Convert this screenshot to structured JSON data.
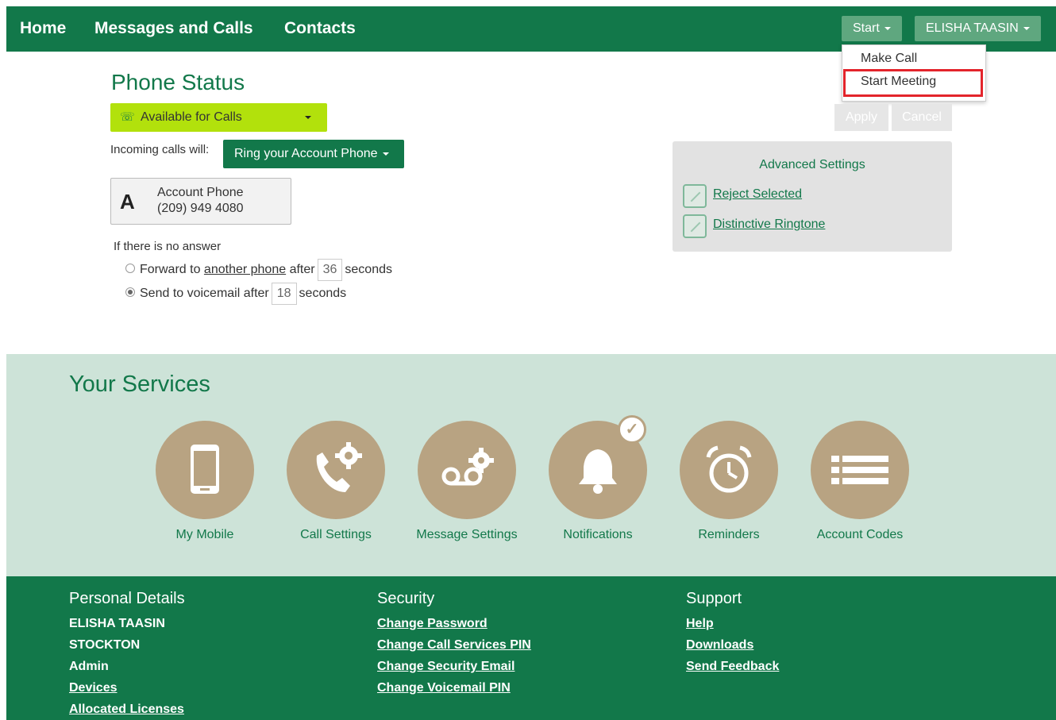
{
  "nav": {
    "home": "Home",
    "messages": "Messages and Calls",
    "contacts": "Contacts",
    "start": "Start",
    "user": "ELISHA TAASIN"
  },
  "start_menu": {
    "items": [
      "Make Call",
      "Start Meeting"
    ],
    "highlighted": "Start Meeting"
  },
  "phone_status": {
    "title": "Phone Status",
    "status": "Available for Calls",
    "incoming_label": "Incoming calls will:",
    "ring_option": "Ring your Account Phone",
    "account_letter": "A",
    "account_name": "Account Phone",
    "account_number": "(209) 949 4080",
    "no_answer": "If there is no answer",
    "forward_prefix": "Forward to",
    "forward_link": "another phone",
    "forward_after": "after",
    "forward_seconds": "36",
    "seconds_label": "seconds",
    "voicemail_prefix": "Send to voicemail after",
    "voicemail_seconds": "18",
    "selected_option": "voicemail"
  },
  "actions": {
    "apply": "Apply",
    "cancel": "Cancel"
  },
  "advanced": {
    "title": "Advanced Settings",
    "links": [
      "Reject Selected",
      "Distinctive Ringtone"
    ]
  },
  "services": {
    "title": "Your Services",
    "items": [
      {
        "label": "My Mobile",
        "icon": "mobile-phone-icon"
      },
      {
        "label": "Call Settings",
        "icon": "phone-gear-icon"
      },
      {
        "label": "Message Settings",
        "icon": "voicemail-gear-icon"
      },
      {
        "label": "Notifications",
        "icon": "bell-icon",
        "checked": true
      },
      {
        "label": "Reminders",
        "icon": "alarm-clock-icon"
      },
      {
        "label": "Account Codes",
        "icon": "list-icon"
      }
    ]
  },
  "footer": {
    "personal": {
      "title": "Personal Details",
      "name": "ELISHA TAASIN",
      "location": "STOCKTON",
      "role": "Admin",
      "devices": "Devices",
      "licenses": "Allocated Licenses"
    },
    "security": {
      "title": "Security",
      "links": [
        "Change Password",
        "Change Call Services PIN",
        "Change Security Email",
        "Change Voicemail PIN"
      ]
    },
    "support": {
      "title": "Support",
      "links": [
        "Help",
        "Downloads",
        "Send Feedback"
      ]
    }
  },
  "colors": {
    "brand": "#12784a",
    "accent": "#b2e10c",
    "service_circle": "#b8a382",
    "highlight": "#e3242b"
  }
}
